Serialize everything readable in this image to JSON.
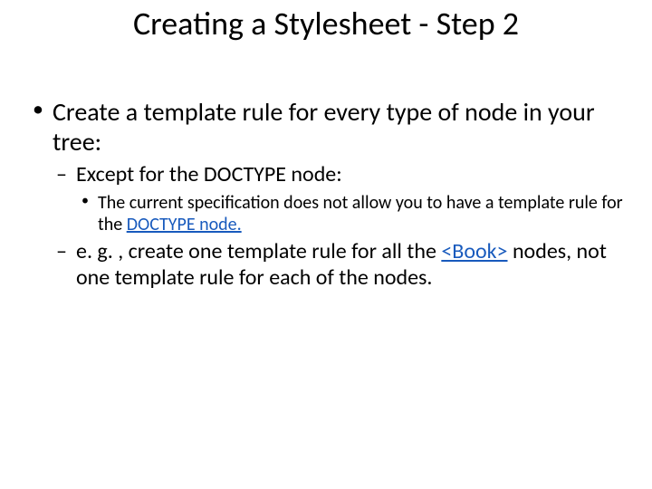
{
  "title": "Creating a Stylesheet - Step 2",
  "body": {
    "l1": "Create a template rule for every type of node in your tree:",
    "l2a": "Except for the DOCTYPE node:",
    "l3a_pre": "The current specification does not allow you to have a template rule for the ",
    "l3a_link": "DOCTYPE node.",
    "l2b_pre": "e. g. , create one template rule for all the ",
    "l2b_link": "<Book>",
    "l2b_post": " nodes, not one template rule for each of the nodes."
  }
}
